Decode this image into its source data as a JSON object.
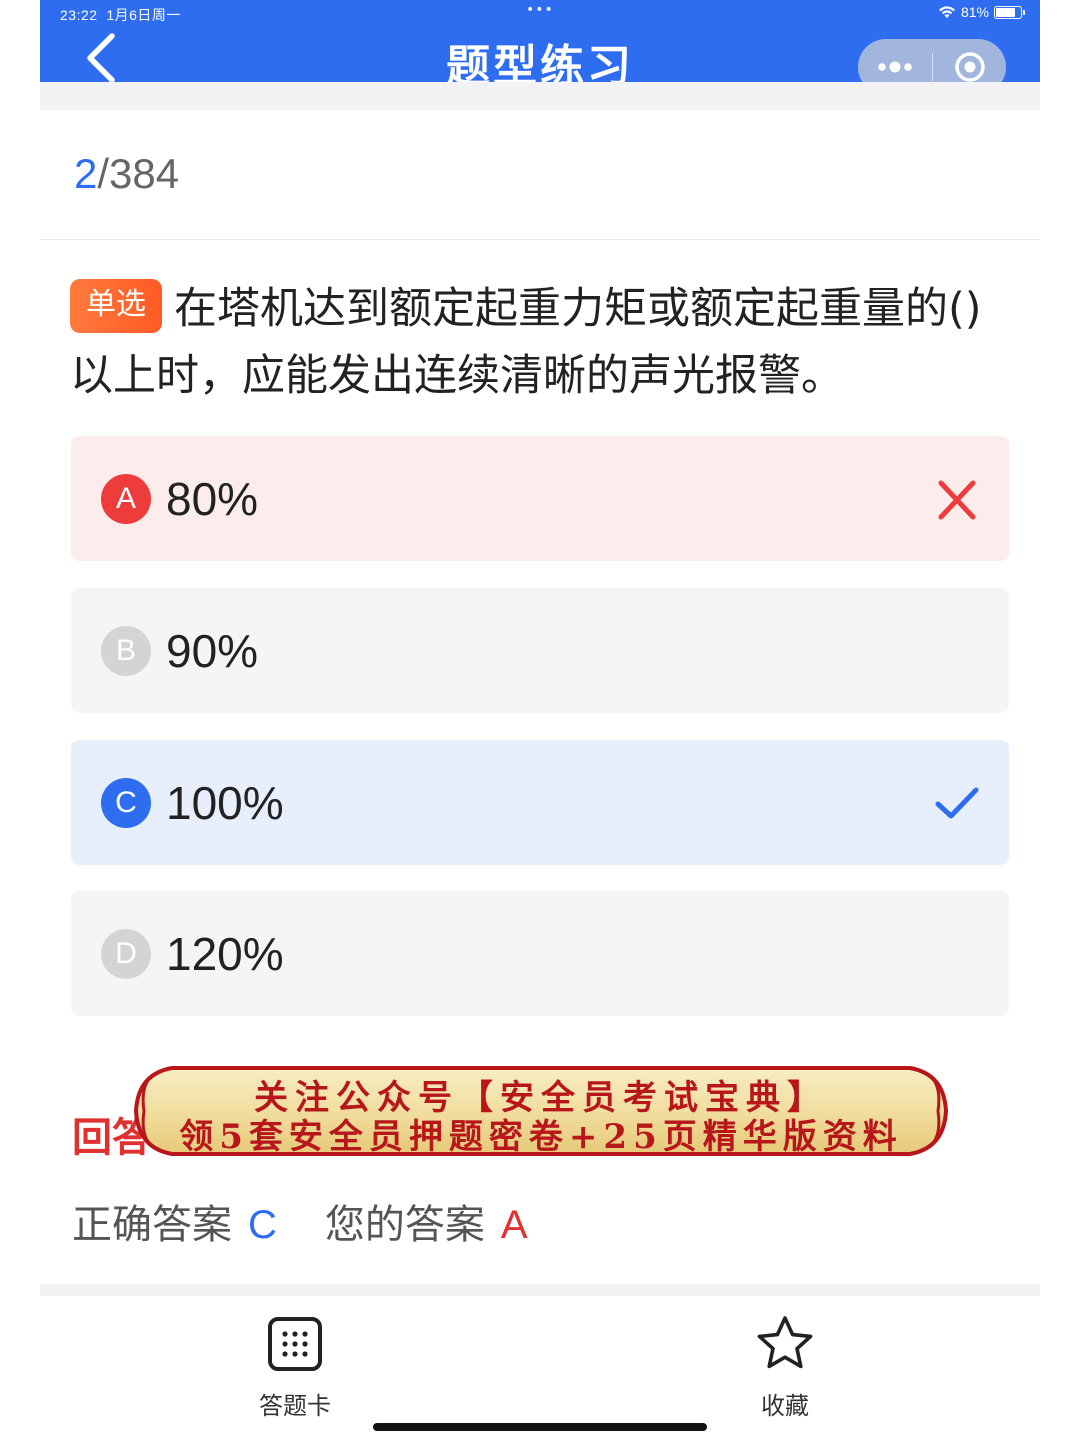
{
  "status_bar": {
    "time": "23:22",
    "date": "1月6日周一",
    "battery": "81%",
    "battery_fraction": 0.81
  },
  "nav": {
    "title": "题型练习",
    "back_icon": "chevron-left-icon",
    "more_icon": "more-dots-icon",
    "close_icon": "target-close-icon"
  },
  "progress": {
    "current": "2",
    "separator": "/",
    "total": "384"
  },
  "question": {
    "type_label": "单选",
    "text": "在塔机达到额定起重力矩或额定起重量的()以上时，应能发出连续清晰的声光报警。"
  },
  "options": [
    {
      "letter": "A",
      "text": "80%",
      "state": "wrong",
      "mark_icon": "cross-icon"
    },
    {
      "letter": "B",
      "text": "90%",
      "state": "normal"
    },
    {
      "letter": "C",
      "text": "100%",
      "state": "correct",
      "mark_icon": "check-icon"
    },
    {
      "letter": "D",
      "text": "120%",
      "state": "normal"
    }
  ],
  "analysis_heading": "回答",
  "promo": {
    "line1": "关注公众号【安全员考试宝典】",
    "line2": "领5套安全员押题密卷+25页精华版资料"
  },
  "answers": {
    "correct_label": "正确答案",
    "correct_value": "C",
    "your_label": "您的答案",
    "your_value": "A"
  },
  "tabbar": {
    "answer_card_label": "答题卡",
    "favorite_label": "收藏"
  },
  "colors": {
    "primary": "#2f6df0",
    "wrong": "#ee3b3b",
    "badge": "#ff6a30"
  }
}
